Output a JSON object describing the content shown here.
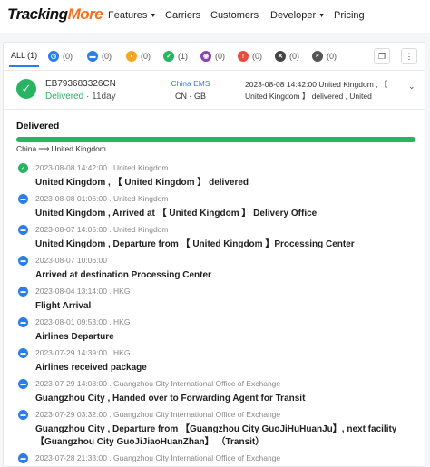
{
  "header": {
    "logo_part1": "Tracking",
    "logo_part2": "More",
    "nav": [
      {
        "label": "Features",
        "has_dropdown": true
      },
      {
        "label": "Carriers",
        "has_dropdown": false
      },
      {
        "label": "Customers",
        "has_dropdown": false
      },
      {
        "label": "Developer",
        "has_dropdown": true
      },
      {
        "label": "Pricing",
        "has_dropdown": false
      }
    ]
  },
  "filters": {
    "all_label": "ALL (1)",
    "chips": [
      {
        "icon": "pending-icon",
        "count": "(0)",
        "color": "#2b7de9"
      },
      {
        "icon": "transit-icon",
        "count": "(0)",
        "color": "#2b7de9"
      },
      {
        "icon": "pickup-icon",
        "count": "(0)",
        "color": "#f5a623"
      },
      {
        "icon": "delivered-icon",
        "count": "(1)",
        "color": "#28b463"
      },
      {
        "icon": "undelivered-icon",
        "count": "(0)",
        "color": "#8e44ad"
      },
      {
        "icon": "alert-icon",
        "count": "(0)",
        "color": "#e74c3c"
      },
      {
        "icon": "expired-icon",
        "count": "(0)",
        "color": "#444444"
      },
      {
        "icon": "notfound-icon",
        "count": "(0)",
        "color": "#555555"
      }
    ]
  },
  "shipment": {
    "tracking_number": "EB793683326CN",
    "status": "Delivered",
    "days": "· 11day",
    "carrier": "China EMS",
    "route": "CN - GB",
    "latest_event": "2023-08-08 14:42:00 United Kingdom , 【 United Kingdom 】 delivered , United Kingdom"
  },
  "detail": {
    "title": "Delivered",
    "origin": "China",
    "destination": "United Kingdom",
    "progress": 1.0
  },
  "events": [
    {
      "meta": "2023-08-08 14:42:00 . United Kingdom",
      "desc": "United Kingdom , 【 United Kingdom 】 delivered",
      "type": "done"
    },
    {
      "meta": "2023-08-08 01:06:00 . United Kingdom",
      "desc": "United Kingdom , Arrived at 【 United Kingdom 】 Delivery Office",
      "type": "transit"
    },
    {
      "meta": "2023-08-07 14:05:00 . United Kingdom",
      "desc": "United Kingdom , Departure from 【 United Kingdom 】Processing Center",
      "type": "transit"
    },
    {
      "meta": "2023-08-07 10:06:00",
      "desc": "Arrived at destination Processing Center",
      "type": "transit"
    },
    {
      "meta": "2023-08-04 13:14:00 . HKG",
      "desc": "Flight Arrival",
      "type": "transit"
    },
    {
      "meta": "2023-08-01 09:53:00 . HKG",
      "desc": "Airlines Departure",
      "type": "transit"
    },
    {
      "meta": "2023-07-29 14:39:00 . HKG",
      "desc": "Airlines received package",
      "type": "transit"
    },
    {
      "meta": "2023-07-29 14:08:00 . Guangzhou City International Office of Exchange",
      "desc": "Guangzhou City , Handed over to Forwarding Agent for Transit",
      "type": "transit"
    },
    {
      "meta": "2023-07-29 03:32:00 . Guangzhou City International Office of Exchange",
      "desc": "Guangzhou City , Departure from 【Guangzhou City GuoJiHuHuanJu】, next facility 【Guangzhou City GuoJiJiaoHuanZhan】 （Transit）",
      "type": "transit"
    },
    {
      "meta": "2023-07-28 21:33:00 . Guangzhou City International Office of Exchange",
      "desc": "",
      "type": "transit"
    }
  ]
}
